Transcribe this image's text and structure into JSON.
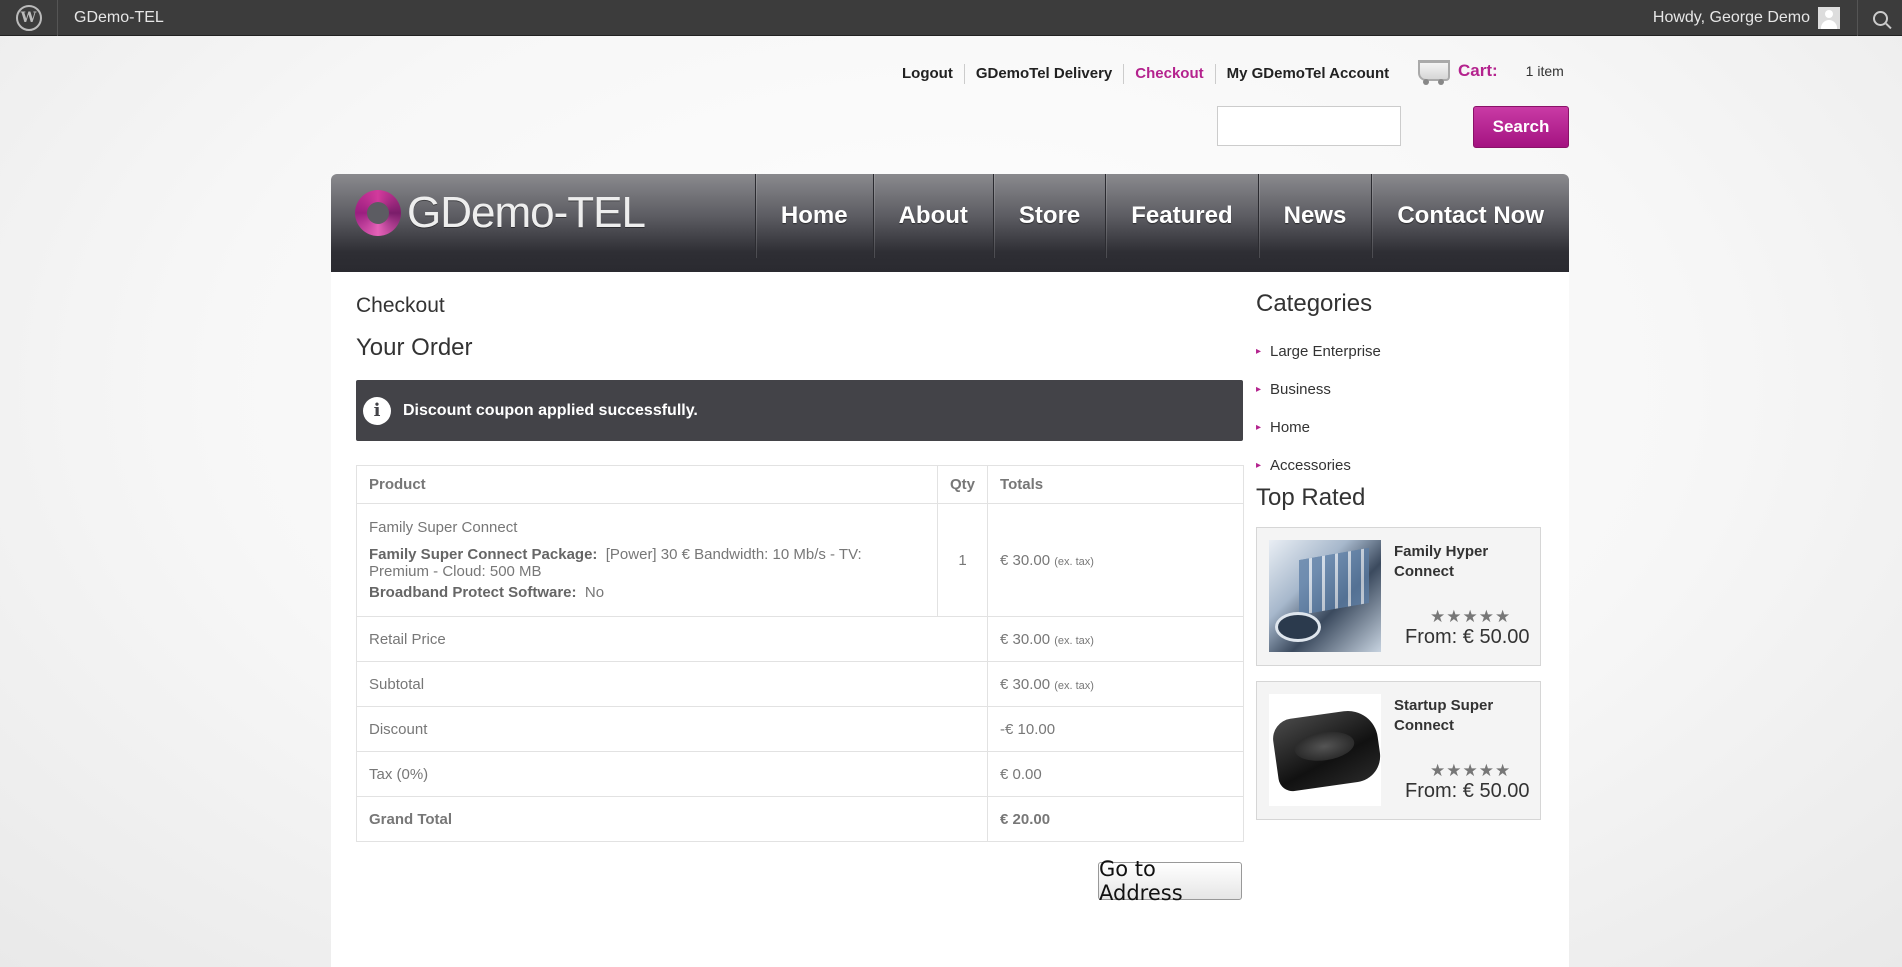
{
  "adminbar": {
    "site_name": "GDemo-TEL",
    "howdy": "Howdy, George Demo"
  },
  "toplinks": [
    {
      "label": "Logout"
    },
    {
      "label": "GDemoTel Delivery"
    },
    {
      "label": "Checkout"
    },
    {
      "label": "My GDemoTel Account"
    }
  ],
  "cart": {
    "label": "Cart:",
    "count": "1 item"
  },
  "search": {
    "button": "Search",
    "placeholder": ""
  },
  "header": {
    "logo_text": "GDemo-TEL",
    "nav": [
      "Home",
      "About",
      "Store",
      "Featured",
      "News",
      "Contact Now"
    ]
  },
  "page": {
    "breadcrumb": "Checkout",
    "title": "Your Order",
    "notice": "Discount coupon applied successfully."
  },
  "order": {
    "headers": {
      "product": "Product",
      "qty": "Qty",
      "totals": "Totals"
    },
    "item": {
      "name": "Family Super Connect",
      "option1_label": "Family Super Connect Package:",
      "option1_value": "[Power] 30 € Bandwidth: 10 Mb/s - TV: Premium - Cloud: 500 MB",
      "option2_label": "Broadband Protect Software:",
      "option2_value": "No",
      "qty": "1",
      "total": "€ 30.00",
      "total_note": "(ex. tax)"
    },
    "summary": [
      {
        "label": "Retail Price",
        "value": "€ 30.00",
        "note": "(ex. tax)"
      },
      {
        "label": "Subtotal",
        "value": "€ 30.00",
        "note": "(ex. tax)"
      },
      {
        "label": "Discount",
        "value": "-€ 10.00",
        "note": ""
      },
      {
        "label": "Tax (0%)",
        "value": "€ 0.00",
        "note": ""
      }
    ],
    "grand_total": {
      "label": "Grand Total",
      "value": "€ 20.00"
    },
    "next_button": "Go to Address"
  },
  "sidebar": {
    "categories_title": "Categories",
    "categories": [
      "Large Enterprise",
      "Business",
      "Home",
      "Accessories"
    ],
    "top_rated_title": "Top Rated",
    "products": [
      {
        "name": "Family Hyper Connect",
        "stars": "★★★★★",
        "rating": 4.5,
        "price": "From: € 50.00"
      },
      {
        "name": "Startup Super Connect",
        "stars": "★★★★★",
        "rating": 5,
        "price": "From: € 50.00"
      }
    ]
  },
  "colors": {
    "accent": "#b4238e",
    "header_dark": "#2e2e34",
    "notice_bg": "#434348"
  }
}
